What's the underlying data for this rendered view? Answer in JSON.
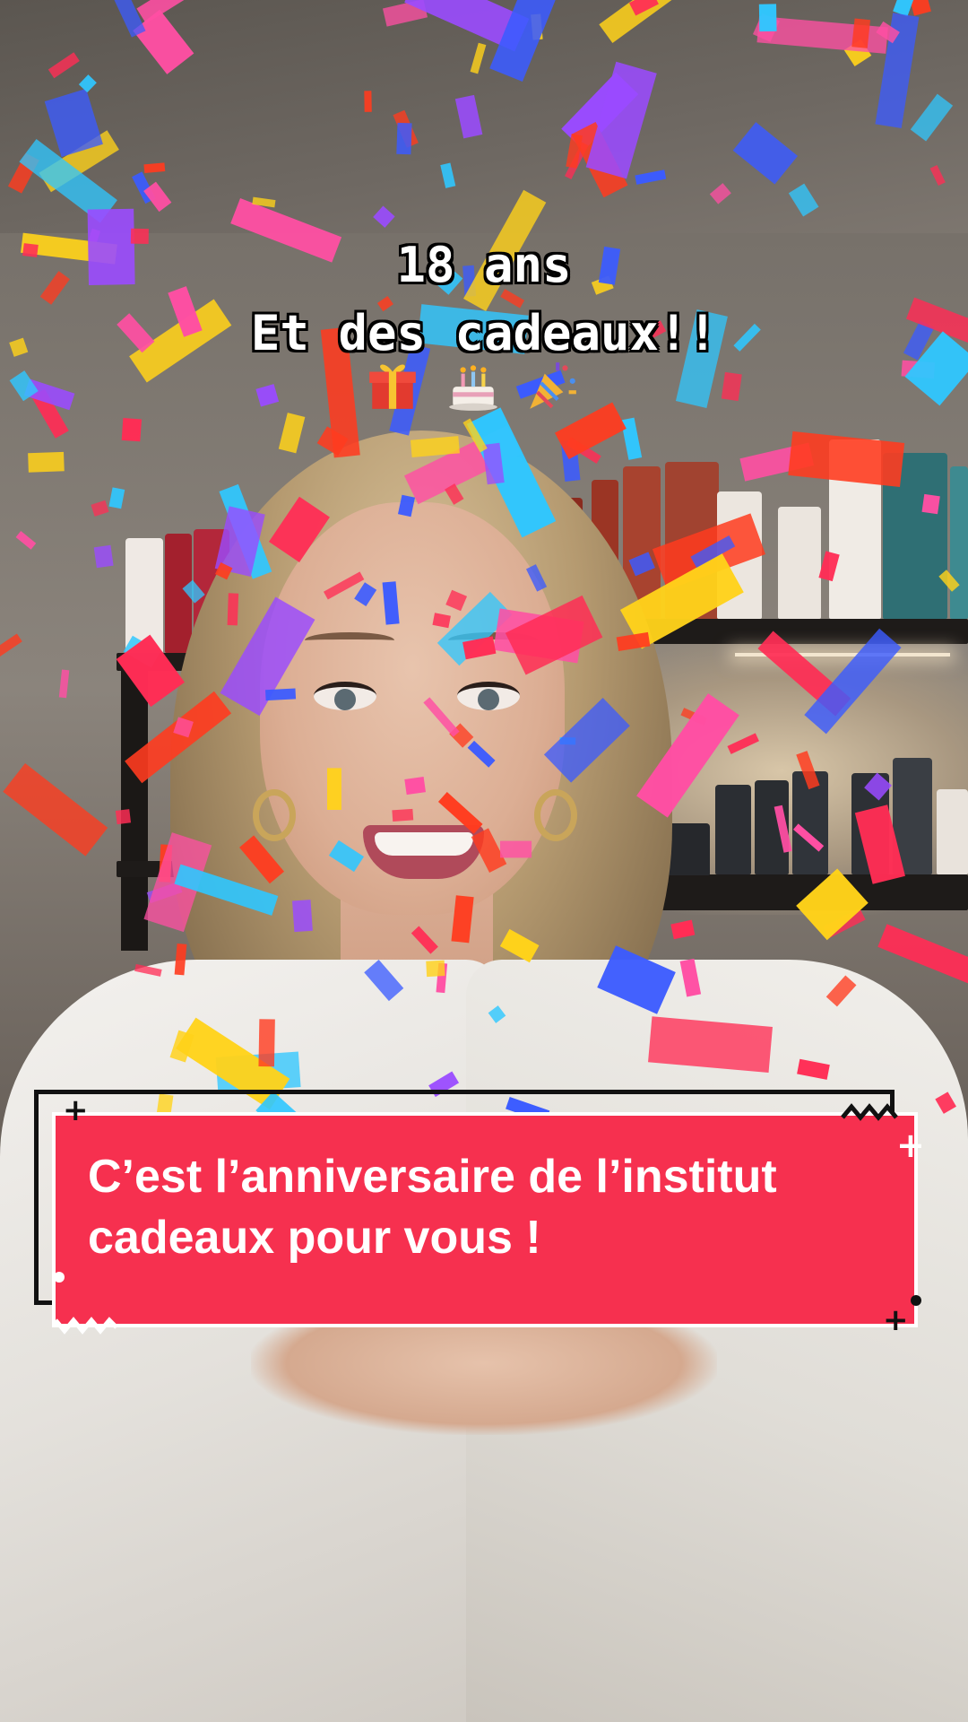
{
  "overlay": {
    "title_line1": "18 ans",
    "title_line2": "Et des cadeaux!!",
    "emojis": [
      "gift-emoji",
      "birthday-cake-emoji",
      "party-popper-emoji"
    ]
  },
  "banner": {
    "line1": "C’est l’anniversaire de l’institut",
    "line2": "cadeaux pour vous !",
    "background_color": "#f6304f",
    "text_color": "#ffffff"
  },
  "confetti_colors": [
    "#3b5bff",
    "#ff2d55",
    "#ffd21a",
    "#2fc7ff",
    "#9a4bff",
    "#ff4fa3",
    "#ff3b1f"
  ]
}
